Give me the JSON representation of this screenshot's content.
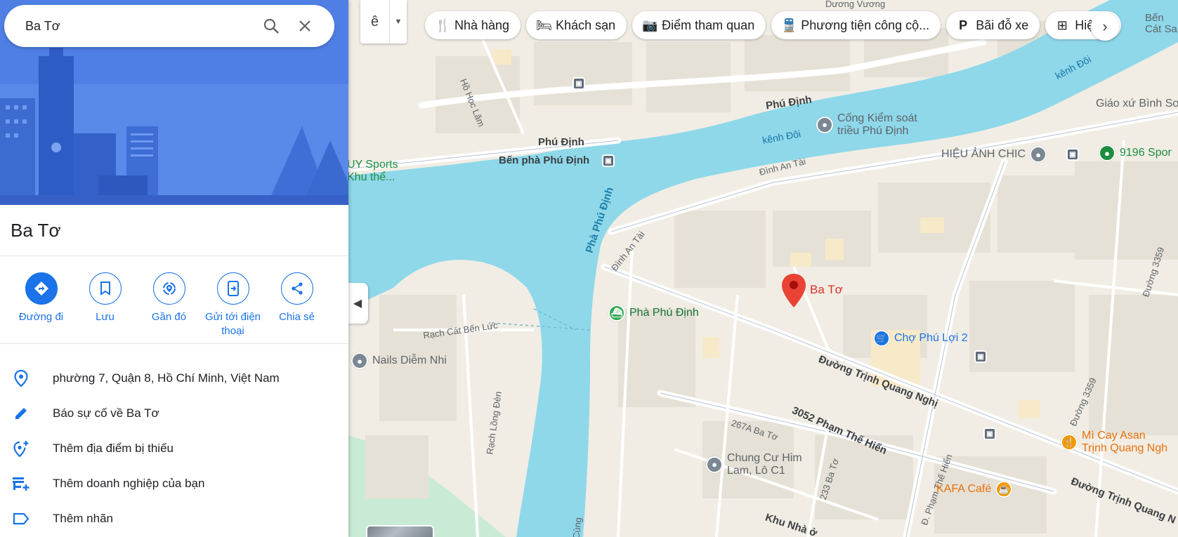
{
  "search": {
    "value": "Ba Tơ",
    "search_icon": "search-icon",
    "clear_icon": "close-icon"
  },
  "place": {
    "title": "Ba Tơ"
  },
  "actions": [
    {
      "label": "Đường đi",
      "icon": "directions-icon"
    },
    {
      "label": "Lưu",
      "icon": "bookmark-icon"
    },
    {
      "label": "Gần đó",
      "icon": "nearby-icon"
    },
    {
      "label": "Gửi tới điện thoại",
      "icon": "send-to-phone-icon"
    },
    {
      "label": "Chia sẻ",
      "icon": "share-icon"
    }
  ],
  "info_rows": [
    {
      "text": "phường 7, Quận 8, Hồ Chí Minh, Việt Nam",
      "icon": "location-pin-icon"
    },
    {
      "text": "Báo sự cố về Ba Tơ",
      "icon": "pencil-icon"
    },
    {
      "text": "Thêm địa điểm bị thiếu",
      "icon": "add-place-icon"
    },
    {
      "text": "Thêm doanh nghiệp của bạn",
      "icon": "add-business-icon"
    },
    {
      "text": "Thêm nhãn",
      "icon": "label-icon"
    }
  ],
  "input_tool": {
    "label": "ê"
  },
  "chips": [
    {
      "label": "Nhà hàng",
      "icon": "restaurant-icon"
    },
    {
      "label": "Khách sạn",
      "icon": "hotel-icon"
    },
    {
      "label": "Điểm tham quan",
      "icon": "camera-icon"
    },
    {
      "label": "Phương tiện công cộ...",
      "icon": "transit-icon"
    },
    {
      "label": "Bãi đỗ xe",
      "icon": "parking-icon"
    },
    {
      "label": "Hiệu",
      "icon": "pharmacy-icon"
    }
  ],
  "map": {
    "pin_label": "Ba Tơ",
    "roads": {
      "duong_vuong": "Dương Vương",
      "phu_dinh_top": "Phú Định",
      "phu_dinh_left": "Phú Định",
      "ho_hoc_lam": "Hồ Học Lãm",
      "dinh_an_tai_1": "Đình An Tài",
      "dinh_an_tai_2": "Đình An Tài",
      "rach_cat_ben_luc": "Rạch Cát Bến Lức",
      "rach_long_den": "Rạch Lồng Đèn",
      "trinh_quang_nghi": "Đường Trịnh Quang Nghị",
      "trinh_quang_nghi_2": "Đường Trịnh Quang N",
      "pham_the_hien": "3052 Phạm Thế Hiển",
      "d_pham_the_hien": "Đ. Phạm Thế Hiển",
      "ba_to_267a": "267A Ba Tơ",
      "ba_to_233": "233 Ba Tơ",
      "duong_3359_a": "Đường 3359",
      "duong_3359_b": "Đường 3359",
      "khu_nha": "Khu Nhà ở",
      "cung": "Cùng"
    },
    "water": {
      "kenh_doi_1": "kênh Đôi",
      "kenh_doi_2": "kênh Đôi",
      "pha_phu_dinh": "Phà Phú Định"
    },
    "pois": {
      "ben_pha": "Bến phà Phú Định",
      "cong_kiem_soat": "Cống Kiểm soát\ntriều Phú Định",
      "giao_xu": "Giáo xứ Bình Sơn",
      "hieu_anh_chic": "HIỆU ẢNH CHIC",
      "sports_9196": "9196 Spor",
      "uy_sports": "UY Sports\nKhu thể...",
      "pha_phu_dinh": "Phà Phú Định",
      "cho_phu_loi": "Chợ Phú Lợi 2",
      "nails": "Nails Diễm Nhi",
      "chung_cu": "Chung Cư Him\nLam, Lô C1",
      "mi_cay": "Mì Cay Asan\nTrịnh Quang Ngh",
      "kafa": "KAFA Café",
      "ben_cat": "Bến\nCát Sa"
    }
  },
  "colors": {
    "accent": "#1a73e8",
    "water": "#8ed8ea",
    "pin": "#ea4335",
    "hero": "#4a7be3"
  }
}
